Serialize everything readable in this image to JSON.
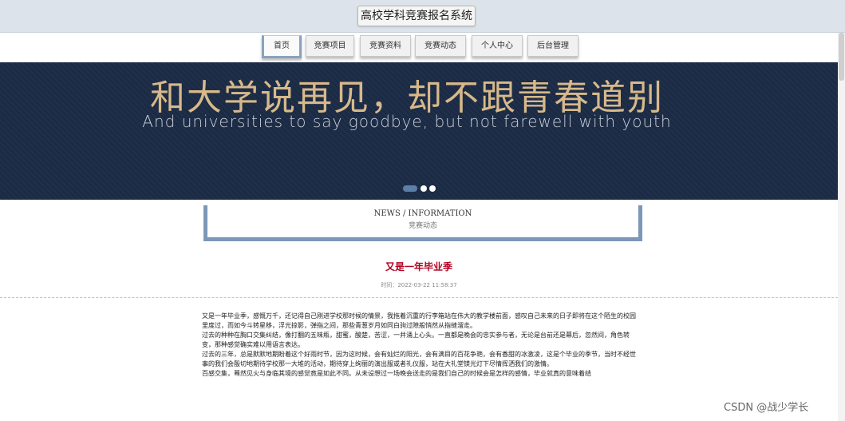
{
  "header": {
    "title": "高校学科竞赛报名系统"
  },
  "nav": {
    "items": [
      {
        "label": "首页",
        "active": true
      },
      {
        "label": "竞赛项目",
        "active": false
      },
      {
        "label": "竞赛资料",
        "active": false
      },
      {
        "label": "竞赛动态",
        "active": false
      },
      {
        "label": "个人中心",
        "active": false
      },
      {
        "label": "后台管理",
        "active": false
      }
    ]
  },
  "banner": {
    "headline": "和大学说再见，却不跟青春道别",
    "subline": "And universities to say goodbye, but not farewell with youth",
    "slides": 3,
    "active_slide": 1
  },
  "section": {
    "title_en": "NEWS / INFORMATION",
    "title_cn": "竞赛动态"
  },
  "article": {
    "title": "又是一年毕业季",
    "time_label": "时间：",
    "time_value": "2022-03-22 11:58:37",
    "paragraphs": [
      "又是一年毕业季，感慨万千，还记得自己刚进学校那时候的情景，我拖着沉重的行李箱站在伟大的教学楼前面，感叹自己未来的日子即将在这个陌生的校园里度过，而如今斗转星移，浮光掠影，弹指之间，那些青葱岁月如同白驹过隙般悄然从指缝溜走。",
      "过去的种种在胸口交集纠结，像打翻的五味瓶，甜蜜，酸楚，苦涩，一并涌上心头。一直都是晚会的忠实参与者，无论是台前还是幕后，忽然间，角色转变，那种感觉确实难以用语言表达。",
      "过去的三年，总是默默地期盼着这个好雨时节，因为这时候，会有灿烂的阳光，会有满目的百花争艳，会有香甜的冰激凌，这是个毕业的季节，当时不经世事的我们会殷切地期待学校那一大堆的活动，期待穿上绚丽的演出服或者礼仪服，站在大礼堂镁光灯下尽情挥洒我们的激情。",
      "百感交集，蓦然见火与身临其境的感觉竟是如此不同。从未设想过一场晚会送走的是我们自己的时候会是怎样的感情，毕业就真的意味着结"
    ]
  },
  "watermark": "CSDN @战少学长",
  "colors": {
    "banner_bg": "#1c2b45",
    "banner_headline": "#d7b98a",
    "accent_border": "#7c97b8",
    "article_title": "#b00020"
  }
}
